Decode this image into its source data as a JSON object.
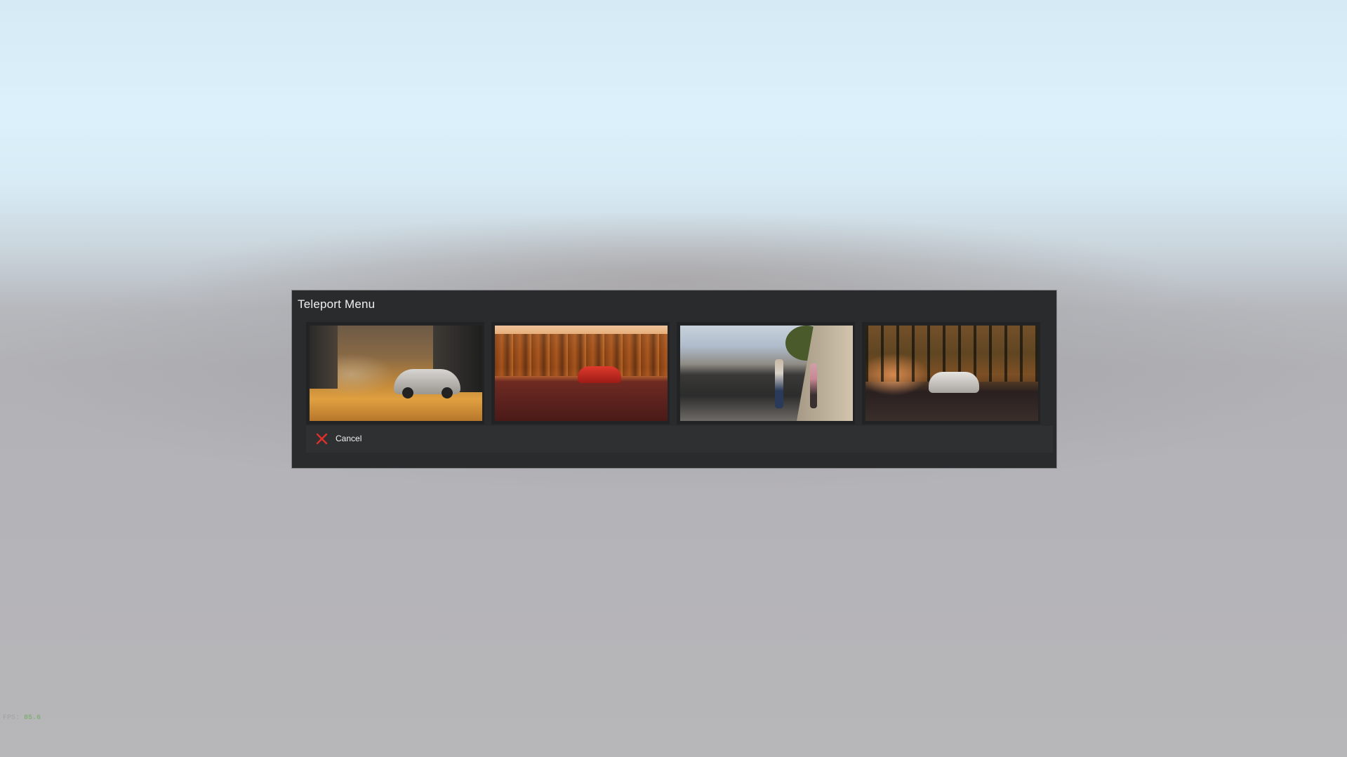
{
  "menu": {
    "title": "Teleport Menu",
    "locations": [
      {
        "id": 1,
        "thumbnail": "city street with silver sports car"
      },
      {
        "id": 2,
        "thumbnail": "autumn forest road with red convertible"
      },
      {
        "id": 3,
        "thumbnail": "sidewalk with two pedestrians"
      },
      {
        "id": 4,
        "thumbnail": "forest road at sunset with white car"
      }
    ],
    "cancel": {
      "label": "Cancel",
      "icon": "close-icon",
      "icon_color": "#e0302a"
    }
  },
  "debug_overlay": {
    "fps_label": "FPS:",
    "fps_value": "85.6"
  },
  "colors": {
    "panel_background": "#2a2b2d",
    "cancel_bar_background": "#2f3032"
  }
}
